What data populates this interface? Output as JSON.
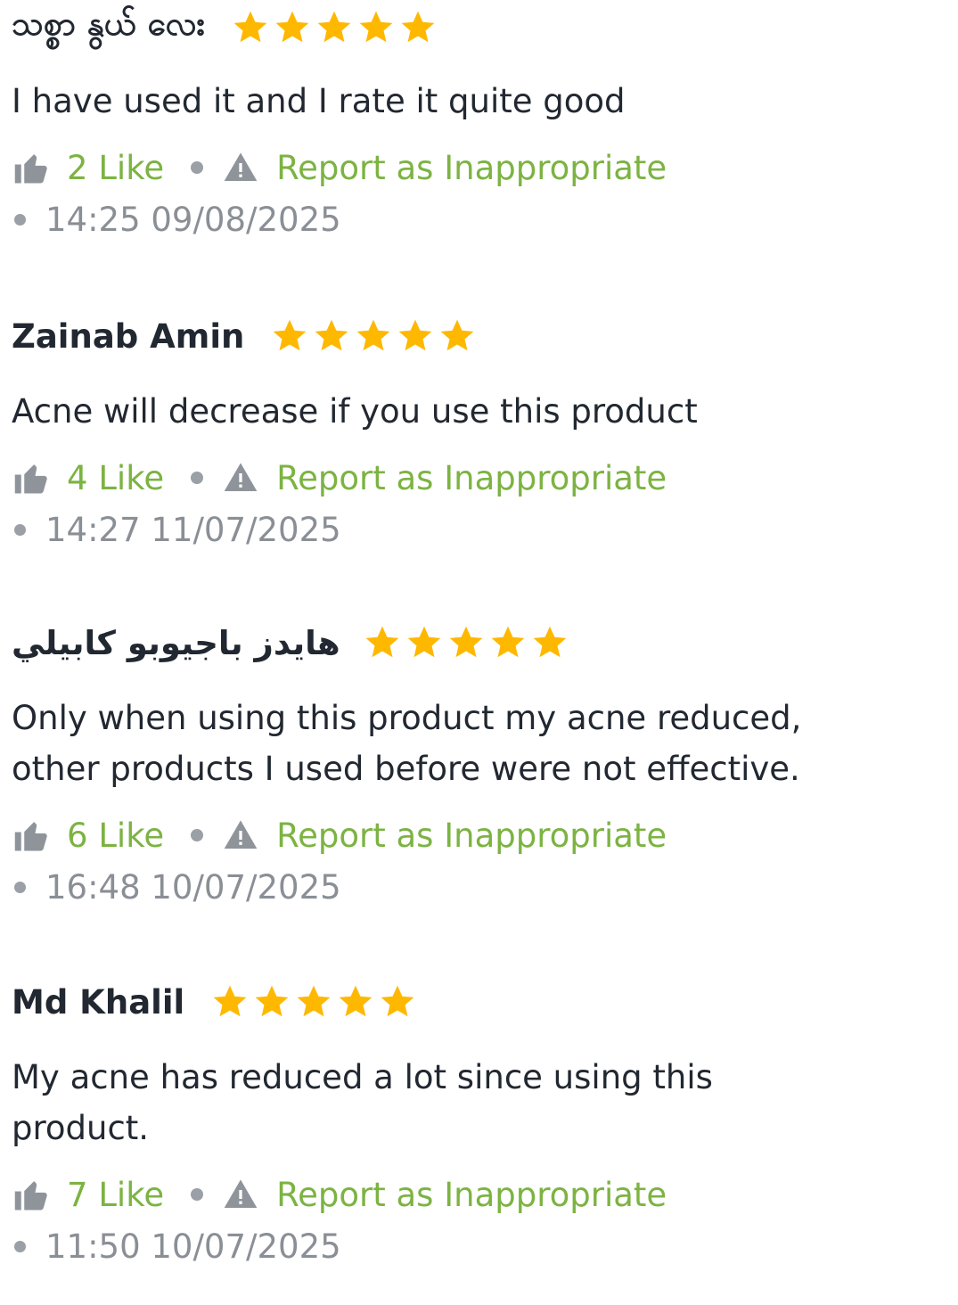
{
  "colors": {
    "star": "#ffb800",
    "accent_green": "#7cb342",
    "name_text": "#222831",
    "muted_gray": "#8a8f96",
    "icon_gray": "#8f949b"
  },
  "reviews": [
    {
      "name": "သစ္စာ နွယ် လေး",
      "rating": 5,
      "comment": "I have used it and I rate it quite good",
      "like_count": "2",
      "like_label": "Like",
      "report_label": "Report as Inappropriate",
      "timestamp": "14:25 09/08/2025"
    },
    {
      "name": "Zainab Amin",
      "rating": 5,
      "comment": "Acne will decrease if you use this product",
      "like_count": "4",
      "like_label": "Like",
      "report_label": "Report as Inappropriate",
      "timestamp": "14:27 11/07/2025"
    },
    {
      "name": "هايدز باجيوبو كابيلي",
      "rating": 5,
      "comment": "Only when using this product my acne reduced,\nother products I used before were not effective.",
      "like_count": "6",
      "like_label": "Like",
      "report_label": "Report as Inappropriate",
      "timestamp": "16:48 10/07/2025"
    },
    {
      "name": "Md Khalil",
      "rating": 5,
      "comment": "My acne has reduced a lot since using this\nproduct.",
      "like_count": "7",
      "like_label": "Like",
      "report_label": "Report as Inappropriate",
      "timestamp": "11:50 10/07/2025"
    }
  ]
}
